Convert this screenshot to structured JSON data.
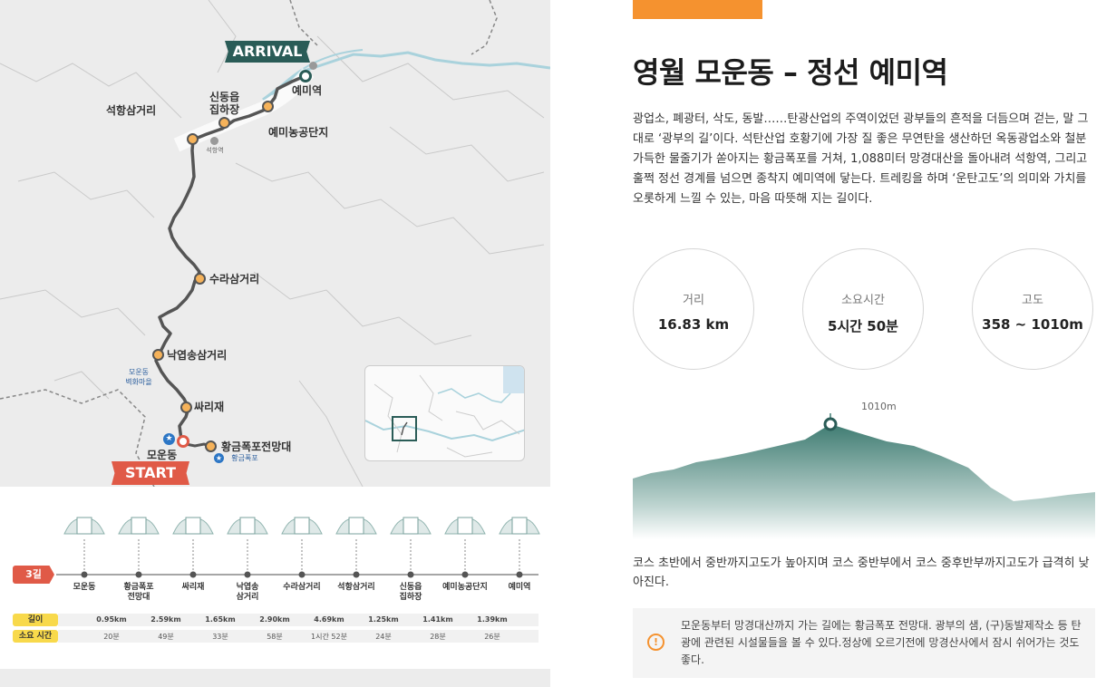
{
  "map": {
    "arrival_badge": "ARRIVAL",
    "start_badge": "START",
    "waypoints": {
      "yemi": "예미역",
      "yemi_farm": "예미농공단지",
      "sindong": "신동읍\n집하장",
      "seokhang": "석항삼거리",
      "sura": "수라삼거리",
      "nakyeop": "낙엽송삼거리",
      "ssari": "싸리재",
      "hwanggeum": "황금폭포전망대",
      "moun": "모운동",
      "moun_village": "모운동\n벽화마을",
      "hwanggeum_fall": "황금폭포",
      "seokhang_station": "석항역"
    }
  },
  "timeline": {
    "route_label": "3길",
    "stops": [
      "모운동",
      "황금폭포\n전망대",
      "싸리재",
      "낙엽송\n삼거리",
      "수라삼거리",
      "석항삼거리",
      "신동읍\n집하장",
      "예미농공단지",
      "예미역"
    ],
    "distance_label": "길이",
    "time_label": "소요 시간",
    "distances": [
      "0.95km",
      "2.59km",
      "1.65km",
      "2.90km",
      "4.69km",
      "1.25km",
      "1.41km",
      "1.39km"
    ],
    "times": [
      "20분",
      "49분",
      "33분",
      "58분",
      "1시간 52분",
      "24분",
      "28분",
      "26분"
    ]
  },
  "detail": {
    "title": "영월 모운동 – 정선 예미역",
    "description": "광업소, 폐광터, 삭도, 동발……탄광산업의 주역이었던 광부들의 흔적을 더듬으며 걷는, 말 그대로 ‘광부의 길’이다. 석탄산업 호황기에 가장 질 좋은 무연탄을 생산하던 옥동광업소와 철분 가득한 물줄기가 쏟아지는 황금폭포를 거쳐, 1,088미터 망경대산을 돌아내려 석항역, 그리고 훌쩍 정선 경계를 넘으면 종착지 예미역에 닿는다. 트레킹을 하며 ‘운탄고도’의 의미와 가치를 오롯하게 느낄 수 있는, 마음 따뜻해 지는 길이다.",
    "stats": [
      {
        "label": "거리",
        "value": "16.83 km"
      },
      {
        "label": "소요시간",
        "value": "5시간 50분"
      },
      {
        "label": "고도",
        "value": "358 ~ 1010m"
      }
    ],
    "peak_label": "1010m",
    "elevation_desc": "코스 초반에서 중반까지고도가 높아지며 코스 중반부에서 코스 중후반부까지고도가 급격히 낮아진다.",
    "note_icon": "info-icon",
    "note": "모운동부터 망경대산까지 가는 길에는 황금폭포 전망대. 광부의 샘, (구)동발제작소 등 탄광에 관련된 시설물들을 볼 수 있다.정상에 오르기전에 망경산사에서 잠시 쉬어가는 것도 좋다.",
    "colors": {
      "accent": "#f5922f",
      "route": "#555555",
      "start": "#e05a47",
      "arrival": "#2a5c57",
      "waypoint": "#f5b25a",
      "elevation": "#3f7c72"
    }
  }
}
